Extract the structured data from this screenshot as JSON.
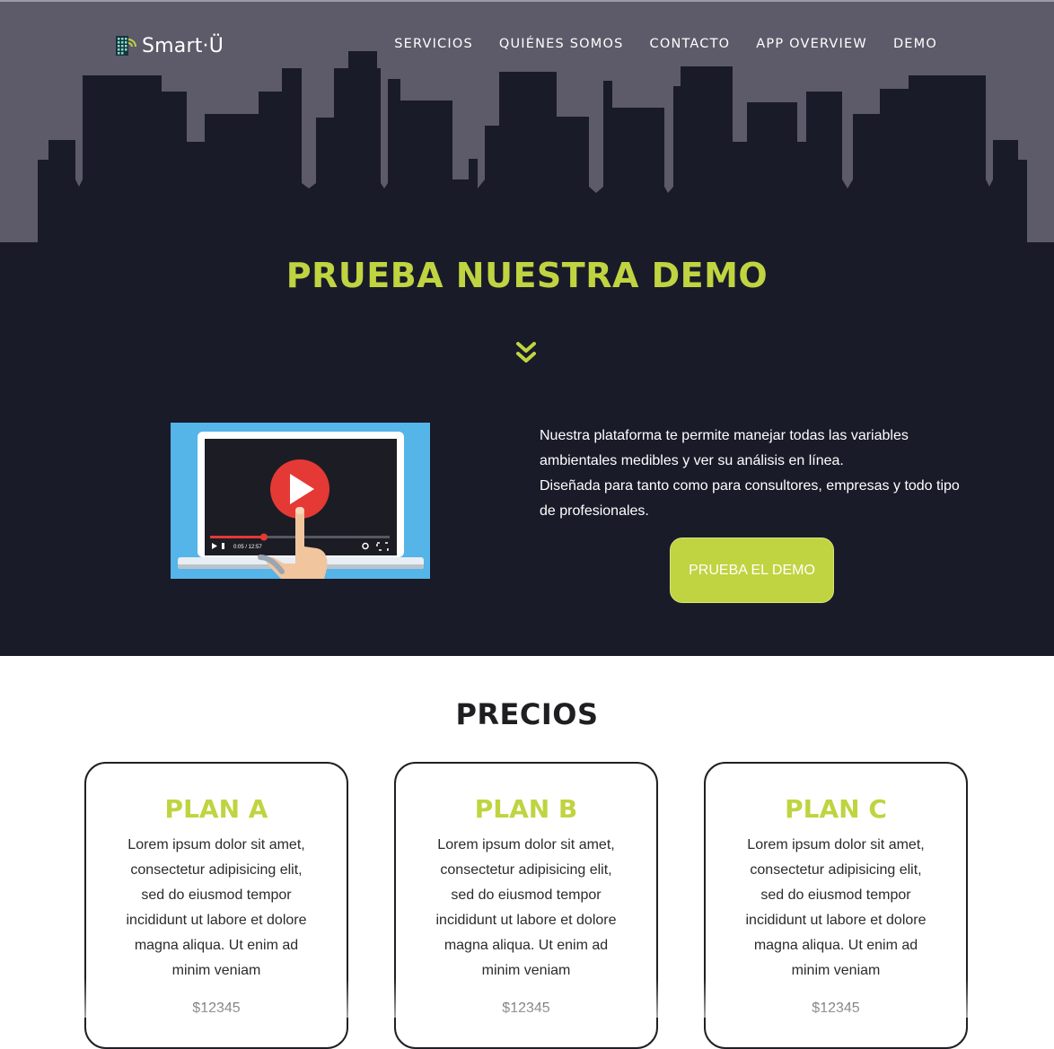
{
  "brand": {
    "name": "Smart·Ü"
  },
  "nav": {
    "items": [
      {
        "label": "SERVICIOS"
      },
      {
        "label": "QUIÉNES SOMOS"
      },
      {
        "label": "CONTACTO"
      },
      {
        "label": "APP OVERVIEW"
      },
      {
        "label": "DEMO"
      }
    ]
  },
  "demo": {
    "title": "PRUEBA NUESTRA DEMO",
    "paragraph_1": "Nuestra plataforma te permite manejar todas las variables ambientales medibles y ver su análisis en línea.",
    "paragraph_2": "Diseñada para tanto como para consultores, empresas y todo tipo de profesionales.",
    "button_label": "PRUEBA EL DEMO",
    "video_time": "0:05 / 12:57",
    "video_progress": 0.3
  },
  "pricing": {
    "title": "PRECIOS",
    "plans": [
      {
        "name": "PLAN A",
        "description": "Lorem ipsum dolor sit amet, consectetur adipisicing elit, sed do eiusmod tempor incididunt ut labore et dolore magna aliqua. Ut enim ad minim veniam",
        "price": "$12345"
      },
      {
        "name": "PLAN B",
        "description": "Lorem ipsum dolor sit amet, consectetur adipisicing elit, sed do eiusmod tempor incididunt ut labore et dolore magna aliqua. Ut enim ad minim veniam",
        "price": "$12345"
      },
      {
        "name": "PLAN C",
        "description": "Lorem ipsum dolor sit amet, consectetur adipisicing elit, sed do eiusmod tempor incididunt ut labore et dolore magna aliqua. Ut enim ad minim veniam",
        "price": "$12345"
      }
    ]
  },
  "colors": {
    "accent": "#bfd440",
    "hero_background": "#191b29",
    "sky": "#5d5b69",
    "video_background": "#55b4e8",
    "play_button": "#e53935"
  },
  "icons": {
    "logo": "building-grid-icon",
    "scroll_down": "double-chevron-down-icon",
    "play": "play-icon"
  }
}
